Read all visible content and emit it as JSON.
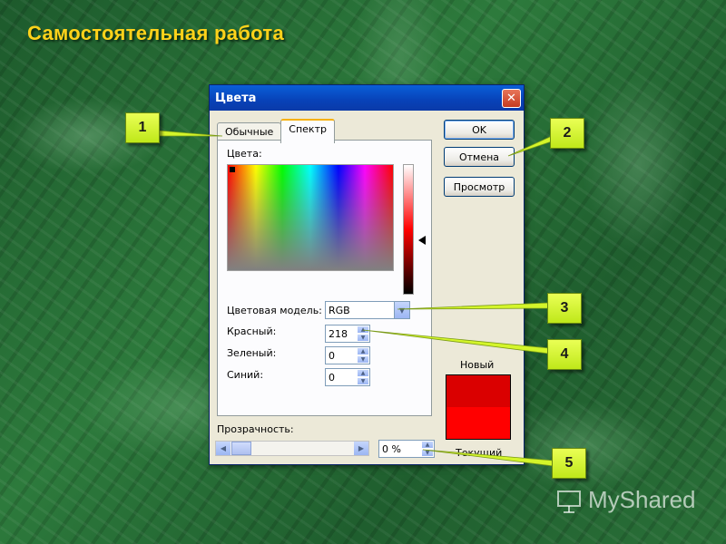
{
  "slide": {
    "title": "Самостоятельная работа"
  },
  "watermark": {
    "text": "MyShared"
  },
  "dialog": {
    "title": "Цвета",
    "close_glyph": "✕",
    "tabs": [
      {
        "label": "Обычные",
        "active": false
      },
      {
        "label": "Спектр",
        "active": true
      }
    ],
    "colors_label": "Цвета:",
    "color_model": {
      "label": "Цветовая модель:",
      "value": "RGB"
    },
    "channels": [
      {
        "label": "Красный:",
        "value": "218"
      },
      {
        "label": "Зеленый:",
        "value": "0"
      },
      {
        "label": "Синий:",
        "value": "0"
      }
    ],
    "buttons": {
      "ok": "OK",
      "cancel": "Отмена",
      "preview": "Просмотр"
    },
    "new_label": "Новый",
    "current_label": "Текущий",
    "new_color": "#da0000",
    "current_color": "#ff0000",
    "transparency": {
      "label": "Прозрачность:",
      "value": "0 %"
    }
  },
  "callouts": [
    "1",
    "2",
    "3",
    "4",
    "5"
  ],
  "colors": {
    "title": "#ffd21a",
    "callout": "#d4f52a",
    "titlebar": "#0a52cc"
  }
}
